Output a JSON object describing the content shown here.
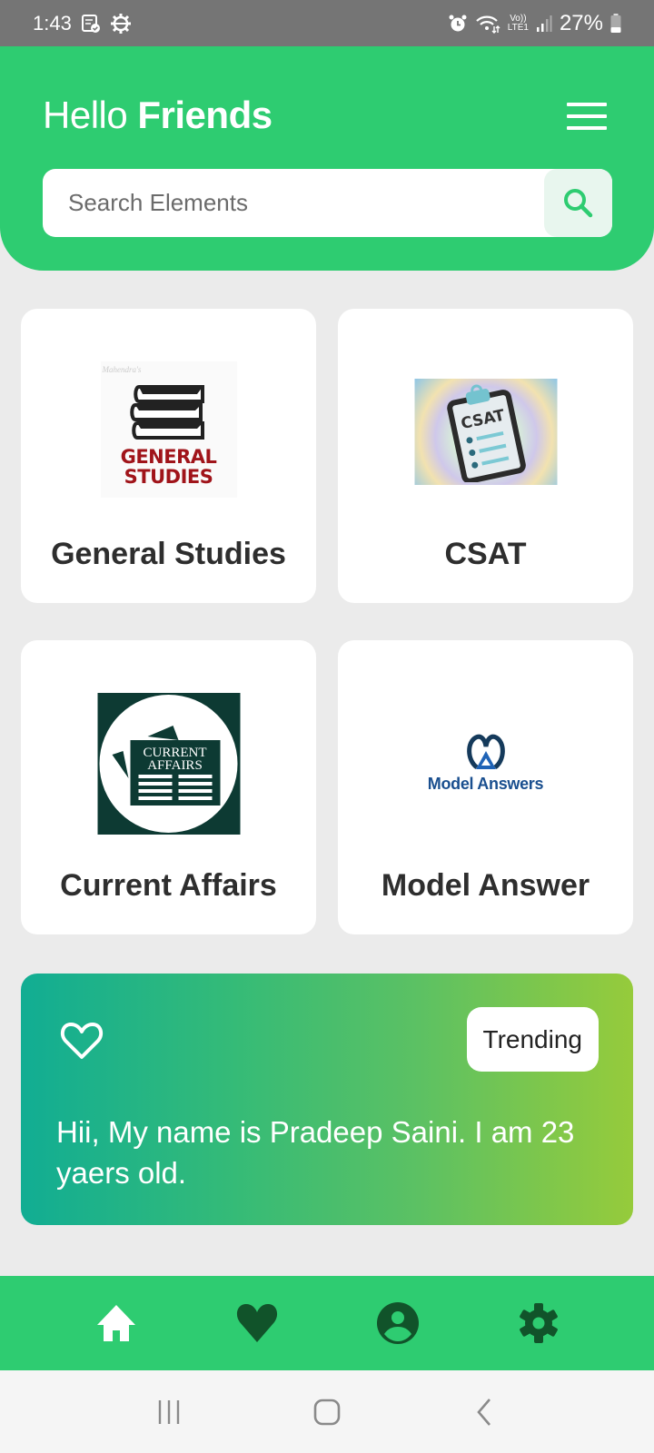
{
  "status_bar": {
    "time": "1:43",
    "battery": "27%",
    "network": "LTE1"
  },
  "header": {
    "greeting_light": "Hello",
    "greeting_bold": "Friends",
    "search_placeholder": "Search Elements",
    "search_value": ""
  },
  "categories": [
    {
      "label": "General Studies",
      "image_text_1": "GENERAL",
      "image_text_2": "STUDIES",
      "image_caption": "Mahendra's"
    },
    {
      "label": "CSAT",
      "image_text_1": "CSAT"
    },
    {
      "label": "Current Affairs",
      "image_text_1": "CURRENT",
      "image_text_2": "AFFAIRS"
    },
    {
      "label": "Model Answer",
      "image_text_1": "Model Answers"
    }
  ],
  "trending": {
    "badge": "Trending",
    "text": "Hii, My name is Pradeep Saini. I am 23 yaers old."
  },
  "bottom_nav": {
    "items": [
      {
        "name": "home",
        "active": true
      },
      {
        "name": "favorites",
        "active": false
      },
      {
        "name": "profile",
        "active": false
      },
      {
        "name": "settings",
        "active": false
      }
    ]
  },
  "colors": {
    "primary": "#2ecc71",
    "nav_icon_inactive": "#11532a",
    "nav_icon_active": "#ffffff",
    "gradient_start": "#11ad93",
    "gradient_end": "#96cb3b"
  }
}
